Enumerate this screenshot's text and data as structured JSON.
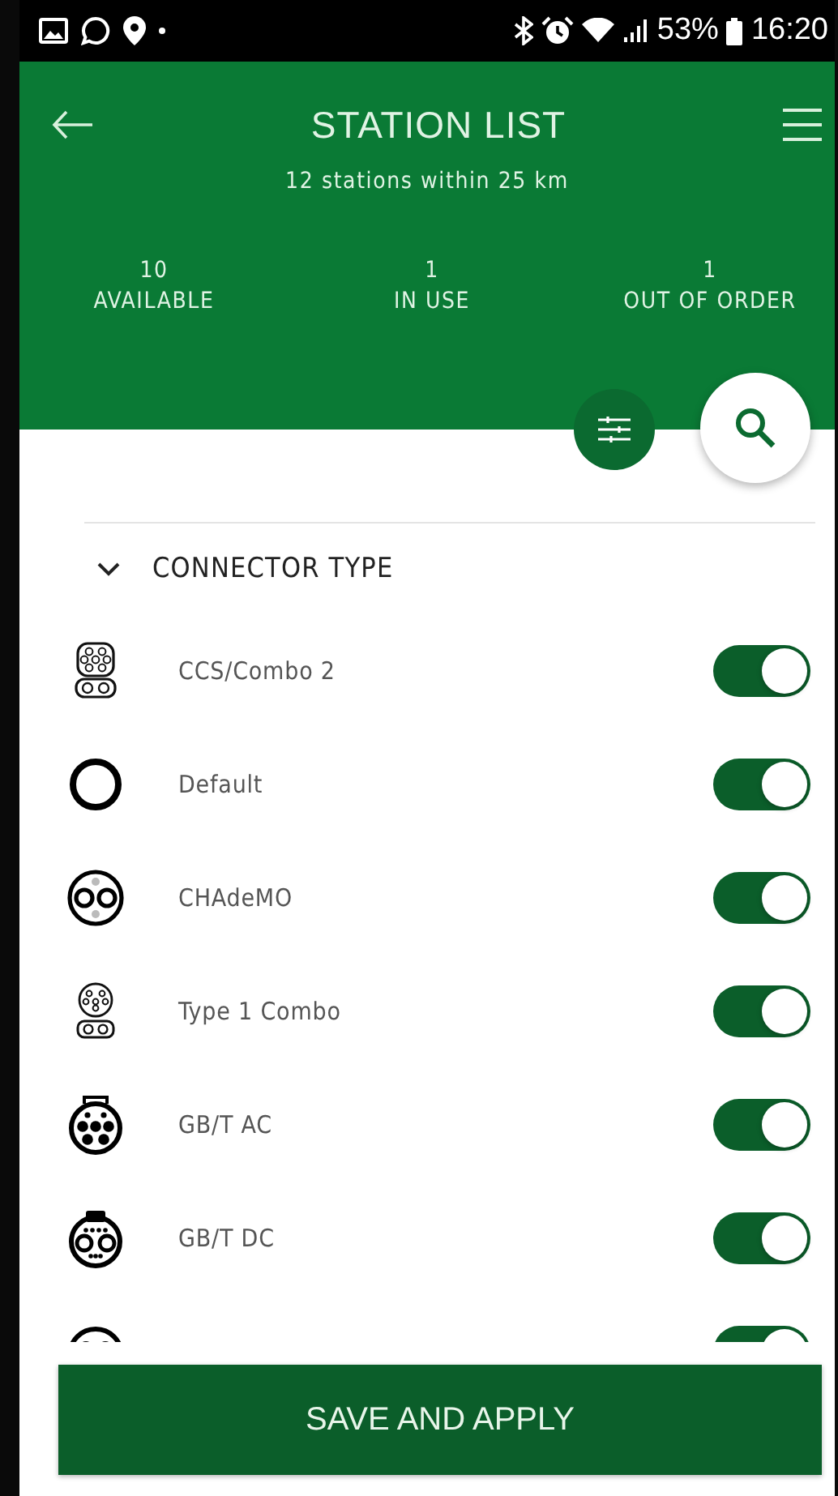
{
  "status_bar": {
    "battery": "53%",
    "time": "16:20"
  },
  "header": {
    "title": "STATION LIST",
    "subtitle": "12 stations within 25 km",
    "stats": [
      {
        "count": "10",
        "label": "AVAILABLE"
      },
      {
        "count": "1",
        "label": "IN USE"
      },
      {
        "count": "1",
        "label": "OUT OF ORDER"
      }
    ]
  },
  "filter_section": {
    "title": "CONNECTOR TYPE",
    "expanded": true,
    "connectors": [
      {
        "kind": "ccs2",
        "name": "CCS/Combo 2",
        "checked": true
      },
      {
        "kind": "ring",
        "name": "Default",
        "checked": true
      },
      {
        "kind": "chademo",
        "name": "CHAdeMO",
        "checked": true
      },
      {
        "kind": "type1combo",
        "name": "Type 1 Combo",
        "checked": true
      },
      {
        "kind": "gbtac",
        "name": "GB/T AC",
        "checked": true
      },
      {
        "kind": "gbtdc",
        "name": "GB/T DC",
        "checked": true
      },
      {
        "kind": "cee",
        "checked": true
      }
    ]
  },
  "save_button": "SAVE AND APPLY"
}
